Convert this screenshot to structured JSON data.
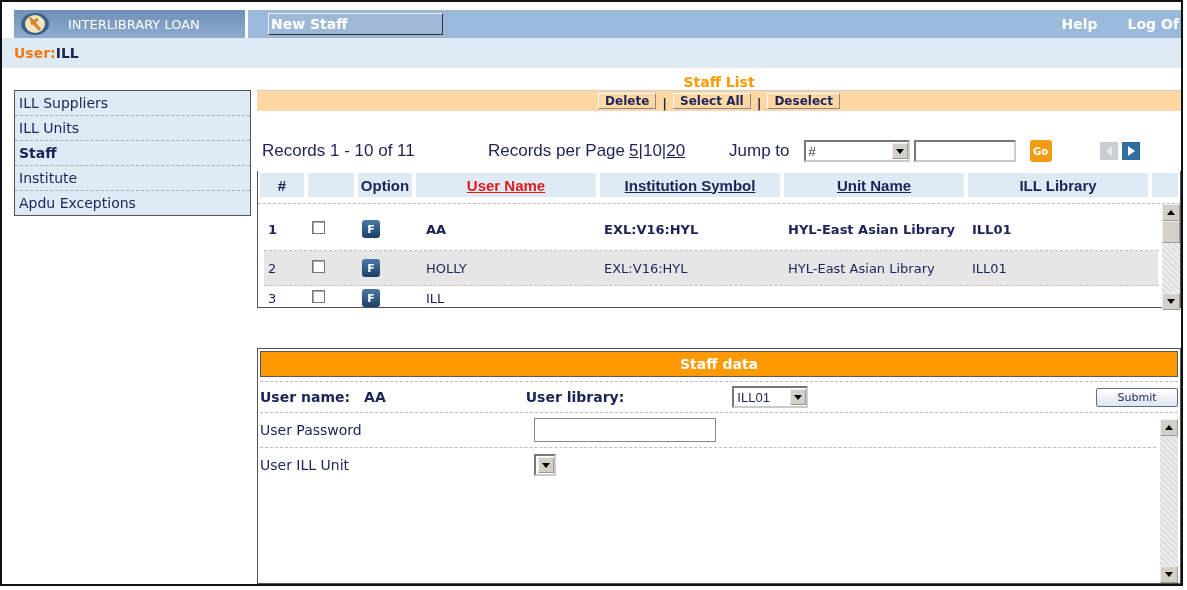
{
  "header": {
    "app_title": "INTERLIBRARY LOAN",
    "page_button": "New Staff",
    "links": [
      "Help",
      "Log Of"
    ]
  },
  "user_bar": {
    "label": "User:",
    "value": "ILL"
  },
  "sidebar": {
    "items": [
      {
        "label": "ILL Suppliers",
        "selected": false
      },
      {
        "label": "ILL Units",
        "selected": false
      },
      {
        "label": "Staff",
        "selected": true
      },
      {
        "label": "Institute",
        "selected": false
      },
      {
        "label": "Apdu Exceptions",
        "selected": false
      }
    ]
  },
  "staff_list": {
    "title": "Staff List",
    "separator": "|",
    "actions": [
      "Delete",
      "Select All",
      "Deselect"
    ],
    "records": "Records 1 - 10 of 11",
    "per_page_label": "Records per Page",
    "per_page_options": [
      {
        "label": "5",
        "selected": false
      },
      {
        "label": "10",
        "selected": true
      },
      {
        "label": "20",
        "selected": false
      }
    ],
    "jump_label": "Jump to",
    "jump_select": "#",
    "go_button": "Go",
    "columns": [
      {
        "label": "#",
        "kind": "plain",
        "sorted": false
      },
      {
        "kind": "blank"
      },
      {
        "label": "Option",
        "kind": "plain",
        "sorted": false
      },
      {
        "label": "User Name",
        "kind": "link",
        "sorted": true
      },
      {
        "label": "Institution Symbol",
        "kind": "link",
        "sorted": false
      },
      {
        "label": "Unit Name",
        "kind": "link",
        "sorted": false
      },
      {
        "label": "ILL Library",
        "kind": "plain",
        "sorted": false
      }
    ],
    "rows": [
      {
        "index": "1",
        "checked": false,
        "option": "F",
        "user_name": "AA",
        "institution_symbol": "EXL:V16:HYL",
        "unit_name": "HYL-East Asian Library",
        "ill_library": "ILL01",
        "selected": true
      },
      {
        "index": "2",
        "checked": false,
        "option": "F",
        "user_name": "HOLLY",
        "institution_symbol": "EXL:V16:HYL",
        "unit_name": "HYL-East Asian Library",
        "ill_library": "ILL01",
        "selected": false
      },
      {
        "index": "3",
        "checked": false,
        "option": "F",
        "user_name": "ILL",
        "selected": false
      }
    ]
  },
  "staff_data": {
    "title": "Staff data",
    "user_name_label": "User name:",
    "user_name": "AA",
    "library_label": "User library:",
    "library_value": "ILL01",
    "submit": "Submit",
    "fields": [
      {
        "label": "User Password",
        "kind": "input"
      },
      {
        "label": "User ILL Unit",
        "kind": "select"
      }
    ]
  }
}
